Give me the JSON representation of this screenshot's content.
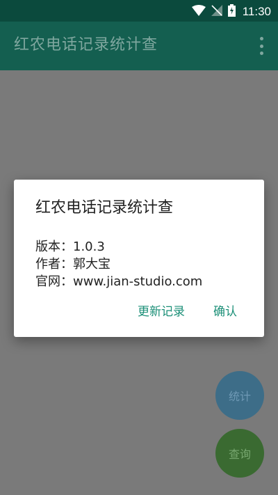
{
  "status_bar": {
    "time": "11:30",
    "icons": [
      "wifi-icon",
      "signal-off-icon",
      "battery-charging-icon"
    ]
  },
  "app_bar": {
    "title": "红农电话记录统计查",
    "menu_icon": "more-vert-icon"
  },
  "dialog": {
    "title": "红农电话记录统计查",
    "version_line": "版本：1.0.3",
    "author_line": "作者：郭大宝",
    "website_line": "官网：www.jian-studio.com",
    "update_log_label": "更新记录",
    "confirm_label": "确认"
  },
  "fabs": {
    "stats_label": "统计",
    "query_label": "查询"
  },
  "colors": {
    "status_bar": "#0b4a3d",
    "app_bar": "#145f50",
    "accent": "#1b8f77",
    "fab_stats": "#3d6d88",
    "fab_query": "#3a6a31"
  }
}
